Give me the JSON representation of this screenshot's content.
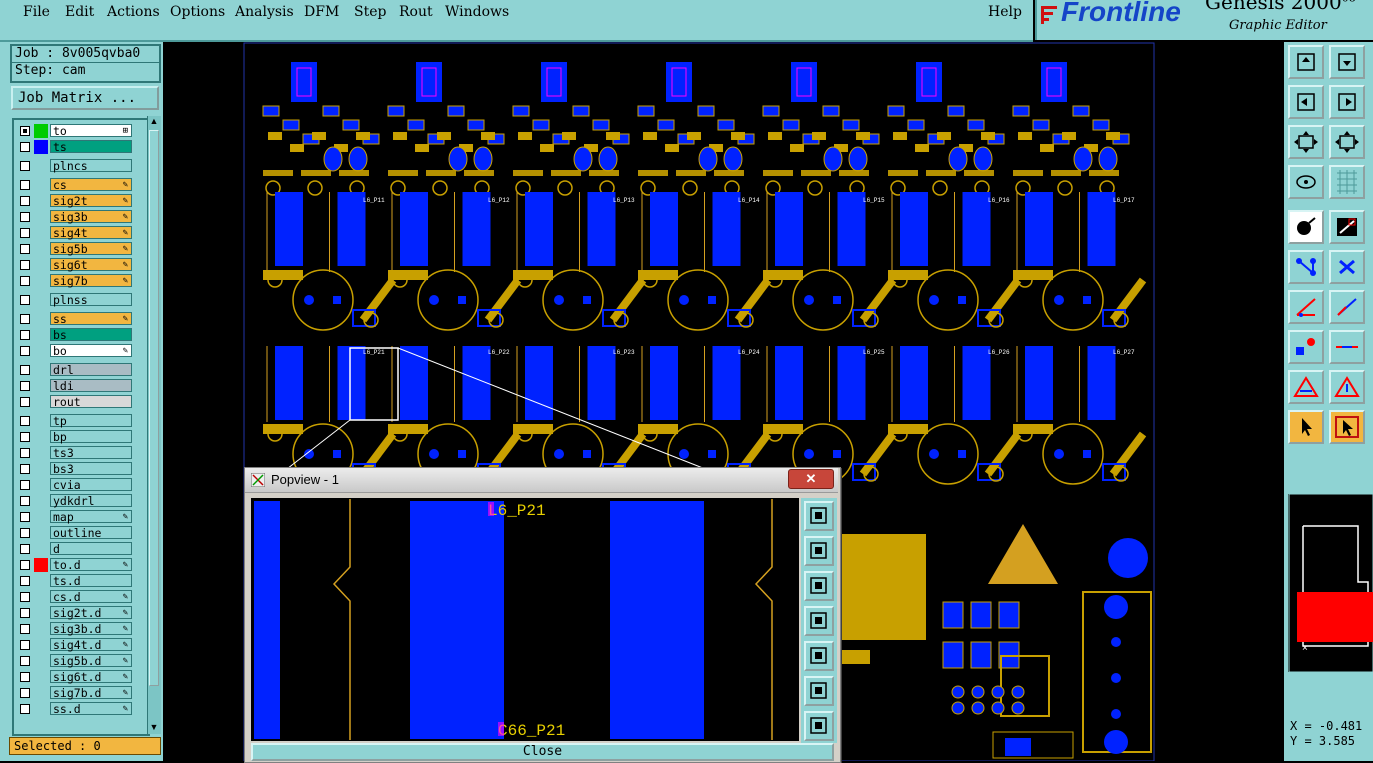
{
  "menubar": {
    "items": [
      "File",
      "Edit",
      "Actions",
      "Options",
      "Analysis",
      "DFM",
      "Step",
      "Rout",
      "Windows"
    ],
    "help": "Help"
  },
  "brand": {
    "logo": "Frontline",
    "product": "Genesis 2000",
    "product_suffix": "08",
    "subtitle": "Graphic Editor"
  },
  "job": {
    "job_label": "Job : 8v005qvba0",
    "step_label": "Step: cam",
    "matrix_button": "Job Matrix ..."
  },
  "layers": [
    {
      "name": "to",
      "color": "#00cc00",
      "bg": "#ffffff",
      "icon": "⊞",
      "checked": true
    },
    {
      "name": "ts",
      "color": "#0000ff",
      "bg": "#00a080",
      "icon": "",
      "checked": false
    },
    {
      "name": "plncs",
      "color": "",
      "bg": "#8fd3d3",
      "icon": "",
      "checked": false
    },
    {
      "name": "cs",
      "color": "",
      "bg": "#f2b640",
      "icon": "✎",
      "checked": false
    },
    {
      "name": "sig2t",
      "color": "",
      "bg": "#f2b640",
      "icon": "✎",
      "checked": false
    },
    {
      "name": "sig3b",
      "color": "",
      "bg": "#f2b640",
      "icon": "✎",
      "checked": false
    },
    {
      "name": "sig4t",
      "color": "",
      "bg": "#f2b640",
      "icon": "✎",
      "checked": false
    },
    {
      "name": "sig5b",
      "color": "",
      "bg": "#f2b640",
      "icon": "✎",
      "checked": false
    },
    {
      "name": "sig6t",
      "color": "",
      "bg": "#f2b640",
      "icon": "✎",
      "checked": false
    },
    {
      "name": "sig7b",
      "color": "",
      "bg": "#f2b640",
      "icon": "✎",
      "checked": false
    },
    {
      "name": "plnss",
      "color": "",
      "bg": "#8fd3d3",
      "icon": "",
      "checked": false
    },
    {
      "name": "ss",
      "color": "",
      "bg": "#f2b640",
      "icon": "✎",
      "checked": false
    },
    {
      "name": "bs",
      "color": "",
      "bg": "#00a080",
      "icon": "",
      "checked": false
    },
    {
      "name": "bo",
      "color": "",
      "bg": "#ffffff",
      "icon": "✎",
      "checked": false
    },
    {
      "name": "drl",
      "color": "",
      "bg": "#a9bcc4",
      "icon": "",
      "checked": false
    },
    {
      "name": "ldi",
      "color": "",
      "bg": "#a9bcc4",
      "icon": "",
      "checked": false
    },
    {
      "name": "rout",
      "color": "",
      "bg": "#d8d8d8",
      "icon": "",
      "checked": false
    },
    {
      "name": "tp",
      "color": "",
      "bg": "#8fd3d3",
      "icon": "",
      "checked": false
    },
    {
      "name": "bp",
      "color": "",
      "bg": "#8fd3d3",
      "icon": "",
      "checked": false
    },
    {
      "name": "ts3",
      "color": "",
      "bg": "#8fd3d3",
      "icon": "",
      "checked": false
    },
    {
      "name": "bs3",
      "color": "",
      "bg": "#8fd3d3",
      "icon": "",
      "checked": false
    },
    {
      "name": "cvia",
      "color": "",
      "bg": "#8fd3d3",
      "icon": "",
      "checked": false
    },
    {
      "name": "ydkdrl",
      "color": "",
      "bg": "#8fd3d3",
      "icon": "",
      "checked": false
    },
    {
      "name": "map",
      "color": "",
      "bg": "#8fd3d3",
      "icon": "✎",
      "checked": false
    },
    {
      "name": "outline",
      "color": "",
      "bg": "#8fd3d3",
      "icon": "",
      "checked": false
    },
    {
      "name": "d",
      "color": "",
      "bg": "#8fd3d3",
      "icon": "",
      "checked": false
    },
    {
      "name": "to.d",
      "color": "#ff0000",
      "bg": "#8fd3d3",
      "icon": "✎",
      "checked": false
    },
    {
      "name": "ts.d",
      "color": "",
      "bg": "#8fd3d3",
      "icon": "",
      "checked": false
    },
    {
      "name": "cs.d",
      "color": "",
      "bg": "#8fd3d3",
      "icon": "✎",
      "checked": false
    },
    {
      "name": "sig2t.d",
      "color": "",
      "bg": "#8fd3d3",
      "icon": "✎",
      "checked": false
    },
    {
      "name": "sig3b.d",
      "color": "",
      "bg": "#8fd3d3",
      "icon": "✎",
      "checked": false
    },
    {
      "name": "sig4t.d",
      "color": "",
      "bg": "#8fd3d3",
      "icon": "✎",
      "checked": false
    },
    {
      "name": "sig5b.d",
      "color": "",
      "bg": "#8fd3d3",
      "icon": "✎",
      "checked": false
    },
    {
      "name": "sig6t.d",
      "color": "",
      "bg": "#8fd3d3",
      "icon": "✎",
      "checked": false
    },
    {
      "name": "sig7b.d",
      "color": "",
      "bg": "#8fd3d3",
      "icon": "✎",
      "checked": false
    },
    {
      "name": "ss.d",
      "color": "",
      "bg": "#8fd3d3",
      "icon": "✎",
      "checked": false
    }
  ],
  "status": {
    "selected": "Selected : 0"
  },
  "coords": {
    "x": "X = -0.481",
    "y": "Y = 3.585"
  },
  "board": {
    "top_labels": [
      "L6_P11",
      "L6_P12",
      "L6_P13",
      "L6_P14",
      "L6_P15",
      "L6_P16",
      "L6_P17"
    ],
    "mid_labels": [
      "L6_P21",
      "L6_P22",
      "L6_P23",
      "L6_P24",
      "L6_P25",
      "L6_P26",
      "L6_P27"
    ],
    "colors": {
      "pad": "#0022ff",
      "copper": "#c8a000",
      "outline": "#d4a020",
      "text": "#ffff00",
      "magenta": "#ff00ff"
    }
  },
  "popview": {
    "title": "Popview - 1",
    "close_x": "✕",
    "label_top": "L6_P21",
    "label_bottom": "C66_P21",
    "close_button": "Close"
  }
}
